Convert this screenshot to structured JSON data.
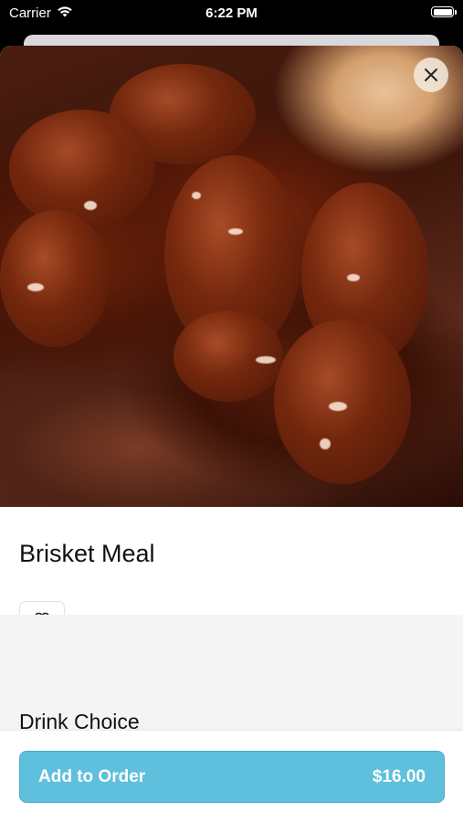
{
  "status_bar": {
    "carrier": "Carrier",
    "time": "6:22 PM"
  },
  "item": {
    "title": "Brisket Meal",
    "image_alt": "brisket-meal-photo"
  },
  "section": {
    "title": "Drink Choice"
  },
  "order_button": {
    "label": "Add to Order",
    "price": "$16.00"
  },
  "colors": {
    "accent": "#5ec0dc",
    "section_background": "#f4f4f5"
  },
  "icons": {
    "wifi": "wifi-icon",
    "battery": "battery-icon",
    "close": "close-icon",
    "favorite": "heart-icon"
  }
}
